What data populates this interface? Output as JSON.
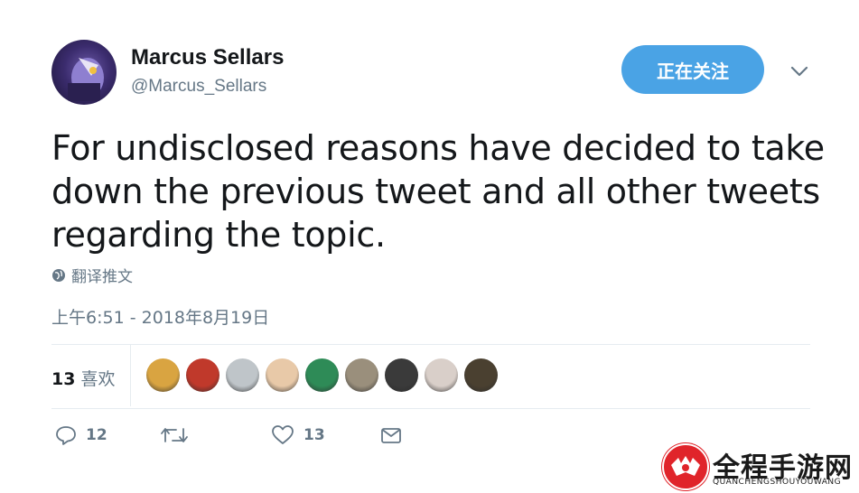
{
  "author": {
    "name": "Marcus Sellars",
    "handle": "@Marcus_Sellars"
  },
  "follow_button": {
    "label": "正在关注"
  },
  "tweet": {
    "text": "For undisclosed reasons have decided to take down the previous tweet and all other tweets regarding the topic.",
    "translate_label": "翻译推文",
    "timestamp": "上午6:51 - 2018年8月19日"
  },
  "likes": {
    "count": "13",
    "label": "喜欢",
    "likers": [
      {
        "color": "#d9a441"
      },
      {
        "color": "#c0392b"
      },
      {
        "color": "#bfc5c9"
      },
      {
        "color": "#e8c9a8"
      },
      {
        "color": "#2e8b57"
      },
      {
        "color": "#9a8f7c"
      },
      {
        "color": "#3a3a3a"
      },
      {
        "color": "#d9cfc9"
      },
      {
        "color": "#4a4030"
      }
    ]
  },
  "actions": {
    "reply_count": "12",
    "retweet_count": "",
    "like_count": "13"
  },
  "watermark": {
    "title": "全程手游网",
    "subtitle": "QUANCHENGSHOUYOUWANG"
  },
  "colors": {
    "accent": "#4aa3e5",
    "secondary_text": "#657786",
    "watermark_red": "#e0242a"
  }
}
